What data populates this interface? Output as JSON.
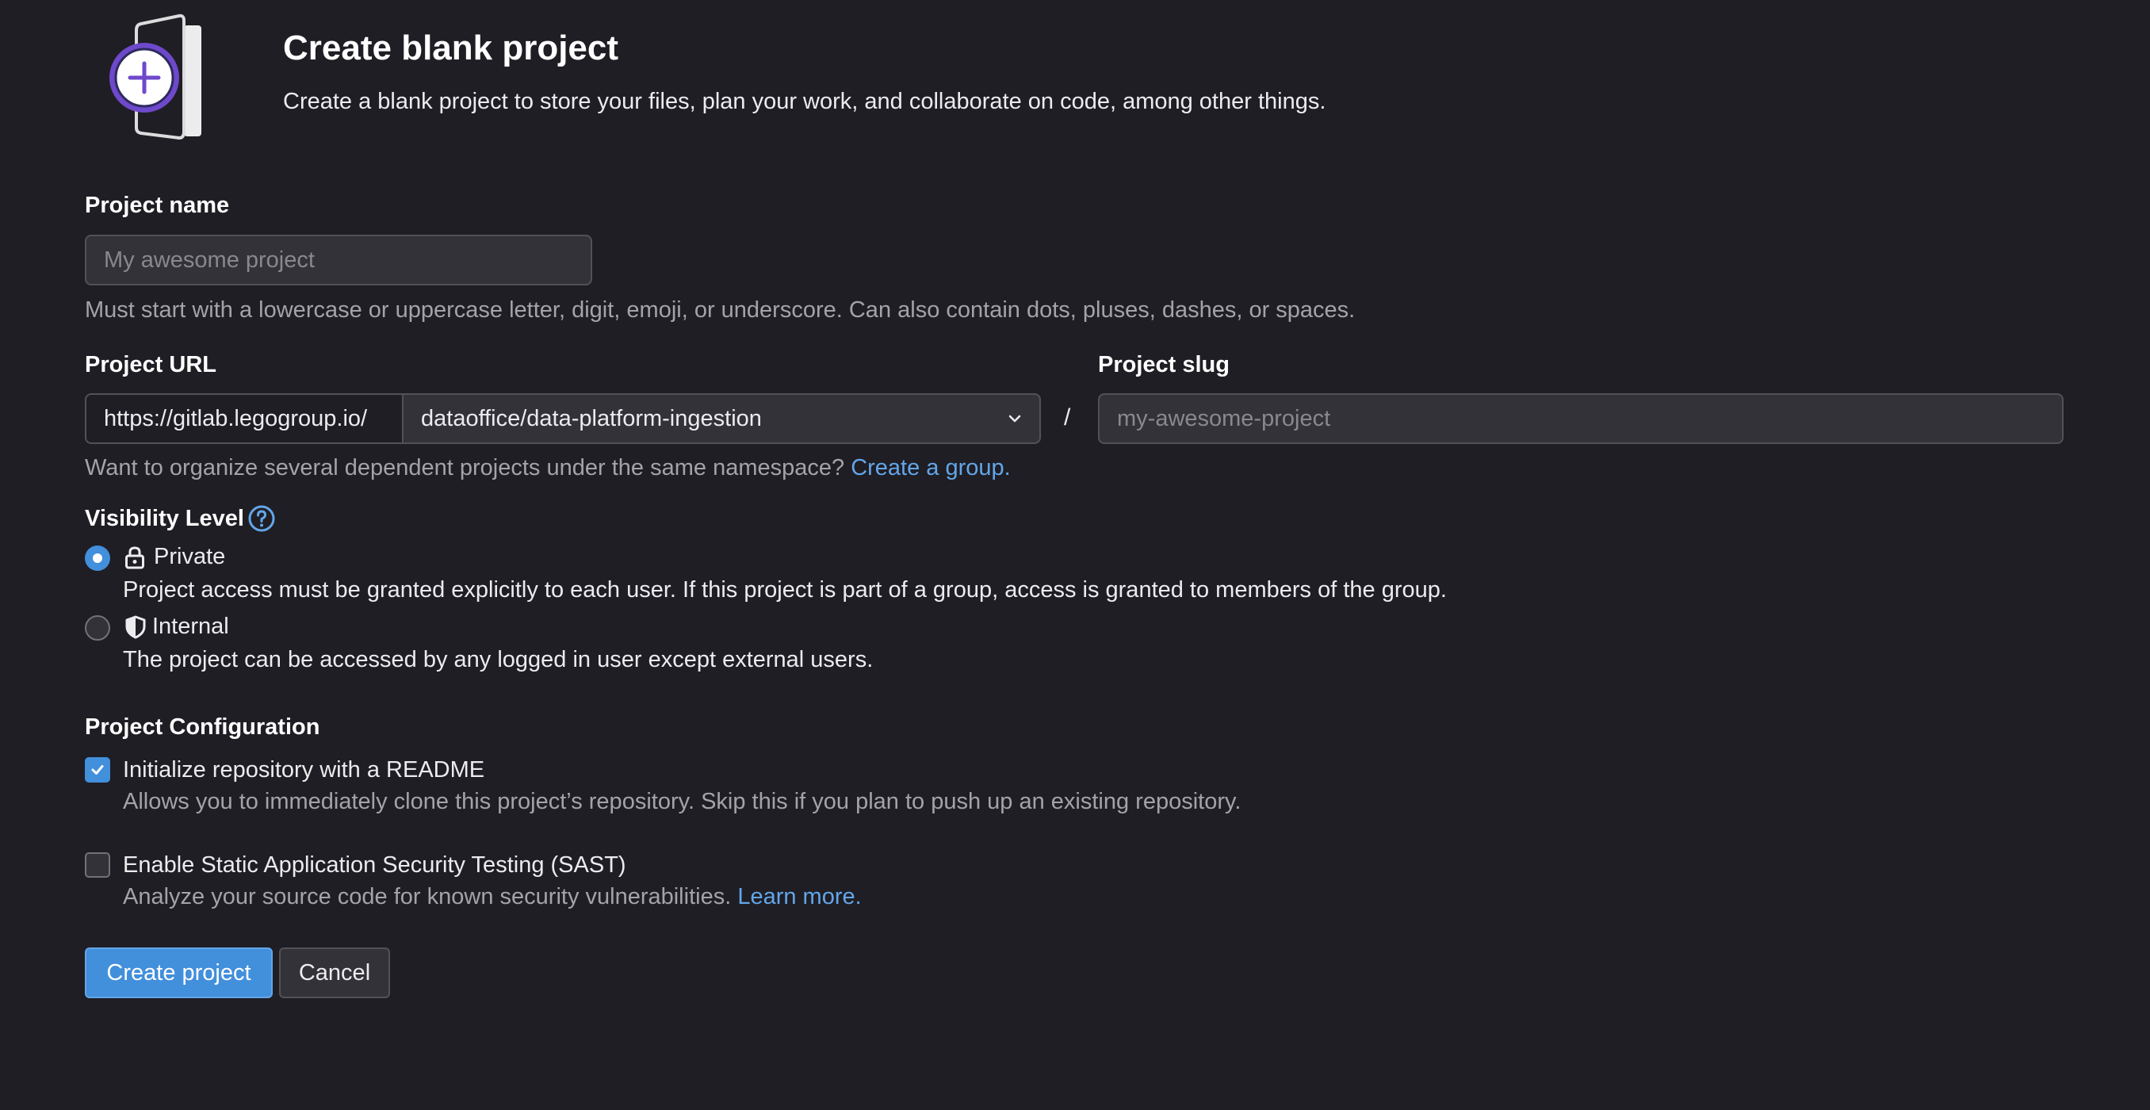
{
  "header": {
    "title": "Create blank project",
    "description": "Create a blank project to store your files, plan your work, and collaborate on code, among other things."
  },
  "project_name": {
    "label": "Project name",
    "placeholder": "My awesome project",
    "value": "",
    "help": "Must start with a lowercase or uppercase letter, digit, emoji, or underscore. Can also contain dots, pluses, dashes, or spaces."
  },
  "project_url": {
    "label": "Project URL",
    "prefix": "https://gitlab.legogroup.io/",
    "namespace": "dataoffice/data-platform-ingestion",
    "separator": "/",
    "help": "Want to organize several dependent projects under the same namespace?",
    "help_link": "Create a group."
  },
  "project_slug": {
    "label": "Project slug",
    "placeholder": "my-awesome-project",
    "value": ""
  },
  "visibility": {
    "label": "Visibility Level",
    "options": [
      {
        "label": "Private",
        "description": "Project access must be granted explicitly to each user. If this project is part of a group, access is granted to members of the group.",
        "selected": true,
        "icon": "lock-icon"
      },
      {
        "label": "Internal",
        "description": "The project can be accessed by any logged in user except external users.",
        "selected": false,
        "icon": "shield-icon"
      }
    ]
  },
  "configuration": {
    "label": "Project Configuration",
    "readme": {
      "label": "Initialize repository with a README",
      "description": "Allows you to immediately clone this project’s repository. Skip this if you plan to push up an existing repository.",
      "checked": true
    },
    "sast": {
      "label": "Enable Static Application Security Testing (SAST)",
      "description": "Analyze your source code for known security vulnerabilities.",
      "link": "Learn more.",
      "checked": false
    }
  },
  "buttons": {
    "create": "Create project",
    "cancel": "Cancel"
  },
  "colors": {
    "background": "#1f1e24",
    "accent": "#428fdc",
    "link": "#63a6e9",
    "illustration_purple": "#6e49cb"
  }
}
